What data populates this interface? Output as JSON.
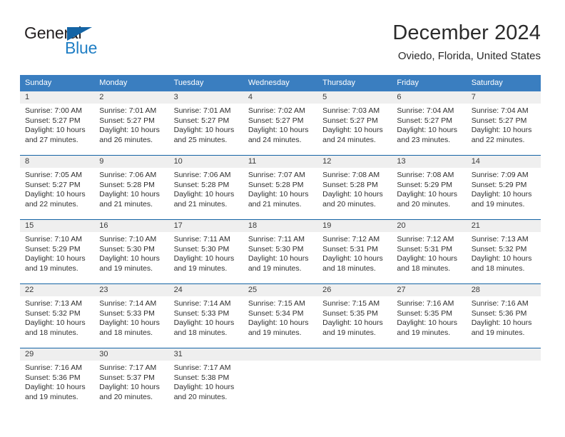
{
  "brand": {
    "name_part1": "General",
    "name_part2": "Blue",
    "accent_color": "#1464a5",
    "blue_text_color": "#1f7ec4"
  },
  "header": {
    "title": "December 2024",
    "subtitle": "Oviedo, Florida, United States"
  },
  "theme": {
    "header_row_bg": "#3a7ec0",
    "day_band_bg": "#efefef",
    "row_separator": "#1464a5"
  },
  "weekday_headers": [
    "Sunday",
    "Monday",
    "Tuesday",
    "Wednesday",
    "Thursday",
    "Friday",
    "Saturday"
  ],
  "weeks": [
    [
      {
        "day": "1",
        "sunrise": "Sunrise: 7:00 AM",
        "sunset": "Sunset: 5:27 PM",
        "daylight_line1": "Daylight: 10 hours",
        "daylight_line2": "and 27 minutes."
      },
      {
        "day": "2",
        "sunrise": "Sunrise: 7:01 AM",
        "sunset": "Sunset: 5:27 PM",
        "daylight_line1": "Daylight: 10 hours",
        "daylight_line2": "and 26 minutes."
      },
      {
        "day": "3",
        "sunrise": "Sunrise: 7:01 AM",
        "sunset": "Sunset: 5:27 PM",
        "daylight_line1": "Daylight: 10 hours",
        "daylight_line2": "and 25 minutes."
      },
      {
        "day": "4",
        "sunrise": "Sunrise: 7:02 AM",
        "sunset": "Sunset: 5:27 PM",
        "daylight_line1": "Daylight: 10 hours",
        "daylight_line2": "and 24 minutes."
      },
      {
        "day": "5",
        "sunrise": "Sunrise: 7:03 AM",
        "sunset": "Sunset: 5:27 PM",
        "daylight_line1": "Daylight: 10 hours",
        "daylight_line2": "and 24 minutes."
      },
      {
        "day": "6",
        "sunrise": "Sunrise: 7:04 AM",
        "sunset": "Sunset: 5:27 PM",
        "daylight_line1": "Daylight: 10 hours",
        "daylight_line2": "and 23 minutes."
      },
      {
        "day": "7",
        "sunrise": "Sunrise: 7:04 AM",
        "sunset": "Sunset: 5:27 PM",
        "daylight_line1": "Daylight: 10 hours",
        "daylight_line2": "and 22 minutes."
      }
    ],
    [
      {
        "day": "8",
        "sunrise": "Sunrise: 7:05 AM",
        "sunset": "Sunset: 5:27 PM",
        "daylight_line1": "Daylight: 10 hours",
        "daylight_line2": "and 22 minutes."
      },
      {
        "day": "9",
        "sunrise": "Sunrise: 7:06 AM",
        "sunset": "Sunset: 5:28 PM",
        "daylight_line1": "Daylight: 10 hours",
        "daylight_line2": "and 21 minutes."
      },
      {
        "day": "10",
        "sunrise": "Sunrise: 7:06 AM",
        "sunset": "Sunset: 5:28 PM",
        "daylight_line1": "Daylight: 10 hours",
        "daylight_line2": "and 21 minutes."
      },
      {
        "day": "11",
        "sunrise": "Sunrise: 7:07 AM",
        "sunset": "Sunset: 5:28 PM",
        "daylight_line1": "Daylight: 10 hours",
        "daylight_line2": "and 21 minutes."
      },
      {
        "day": "12",
        "sunrise": "Sunrise: 7:08 AM",
        "sunset": "Sunset: 5:28 PM",
        "daylight_line1": "Daylight: 10 hours",
        "daylight_line2": "and 20 minutes."
      },
      {
        "day": "13",
        "sunrise": "Sunrise: 7:08 AM",
        "sunset": "Sunset: 5:29 PM",
        "daylight_line1": "Daylight: 10 hours",
        "daylight_line2": "and 20 minutes."
      },
      {
        "day": "14",
        "sunrise": "Sunrise: 7:09 AM",
        "sunset": "Sunset: 5:29 PM",
        "daylight_line1": "Daylight: 10 hours",
        "daylight_line2": "and 19 minutes."
      }
    ],
    [
      {
        "day": "15",
        "sunrise": "Sunrise: 7:10 AM",
        "sunset": "Sunset: 5:29 PM",
        "daylight_line1": "Daylight: 10 hours",
        "daylight_line2": "and 19 minutes."
      },
      {
        "day": "16",
        "sunrise": "Sunrise: 7:10 AM",
        "sunset": "Sunset: 5:30 PM",
        "daylight_line1": "Daylight: 10 hours",
        "daylight_line2": "and 19 minutes."
      },
      {
        "day": "17",
        "sunrise": "Sunrise: 7:11 AM",
        "sunset": "Sunset: 5:30 PM",
        "daylight_line1": "Daylight: 10 hours",
        "daylight_line2": "and 19 minutes."
      },
      {
        "day": "18",
        "sunrise": "Sunrise: 7:11 AM",
        "sunset": "Sunset: 5:30 PM",
        "daylight_line1": "Daylight: 10 hours",
        "daylight_line2": "and 19 minutes."
      },
      {
        "day": "19",
        "sunrise": "Sunrise: 7:12 AM",
        "sunset": "Sunset: 5:31 PM",
        "daylight_line1": "Daylight: 10 hours",
        "daylight_line2": "and 18 minutes."
      },
      {
        "day": "20",
        "sunrise": "Sunrise: 7:12 AM",
        "sunset": "Sunset: 5:31 PM",
        "daylight_line1": "Daylight: 10 hours",
        "daylight_line2": "and 18 minutes."
      },
      {
        "day": "21",
        "sunrise": "Sunrise: 7:13 AM",
        "sunset": "Sunset: 5:32 PM",
        "daylight_line1": "Daylight: 10 hours",
        "daylight_line2": "and 18 minutes."
      }
    ],
    [
      {
        "day": "22",
        "sunrise": "Sunrise: 7:13 AM",
        "sunset": "Sunset: 5:32 PM",
        "daylight_line1": "Daylight: 10 hours",
        "daylight_line2": "and 18 minutes."
      },
      {
        "day": "23",
        "sunrise": "Sunrise: 7:14 AM",
        "sunset": "Sunset: 5:33 PM",
        "daylight_line1": "Daylight: 10 hours",
        "daylight_line2": "and 18 minutes."
      },
      {
        "day": "24",
        "sunrise": "Sunrise: 7:14 AM",
        "sunset": "Sunset: 5:33 PM",
        "daylight_line1": "Daylight: 10 hours",
        "daylight_line2": "and 18 minutes."
      },
      {
        "day": "25",
        "sunrise": "Sunrise: 7:15 AM",
        "sunset": "Sunset: 5:34 PM",
        "daylight_line1": "Daylight: 10 hours",
        "daylight_line2": "and 19 minutes."
      },
      {
        "day": "26",
        "sunrise": "Sunrise: 7:15 AM",
        "sunset": "Sunset: 5:35 PM",
        "daylight_line1": "Daylight: 10 hours",
        "daylight_line2": "and 19 minutes."
      },
      {
        "day": "27",
        "sunrise": "Sunrise: 7:16 AM",
        "sunset": "Sunset: 5:35 PM",
        "daylight_line1": "Daylight: 10 hours",
        "daylight_line2": "and 19 minutes."
      },
      {
        "day": "28",
        "sunrise": "Sunrise: 7:16 AM",
        "sunset": "Sunset: 5:36 PM",
        "daylight_line1": "Daylight: 10 hours",
        "daylight_line2": "and 19 minutes."
      }
    ],
    [
      {
        "day": "29",
        "sunrise": "Sunrise: 7:16 AM",
        "sunset": "Sunset: 5:36 PM",
        "daylight_line1": "Daylight: 10 hours",
        "daylight_line2": "and 19 minutes."
      },
      {
        "day": "30",
        "sunrise": "Sunrise: 7:17 AM",
        "sunset": "Sunset: 5:37 PM",
        "daylight_line1": "Daylight: 10 hours",
        "daylight_line2": "and 20 minutes."
      },
      {
        "day": "31",
        "sunrise": "Sunrise: 7:17 AM",
        "sunset": "Sunset: 5:38 PM",
        "daylight_line1": "Daylight: 10 hours",
        "daylight_line2": "and 20 minutes."
      },
      {
        "day": "",
        "sunrise": "",
        "sunset": "",
        "daylight_line1": "",
        "daylight_line2": ""
      },
      {
        "day": "",
        "sunrise": "",
        "sunset": "",
        "daylight_line1": "",
        "daylight_line2": ""
      },
      {
        "day": "",
        "sunrise": "",
        "sunset": "",
        "daylight_line1": "",
        "daylight_line2": ""
      },
      {
        "day": "",
        "sunrise": "",
        "sunset": "",
        "daylight_line1": "",
        "daylight_line2": ""
      }
    ]
  ]
}
